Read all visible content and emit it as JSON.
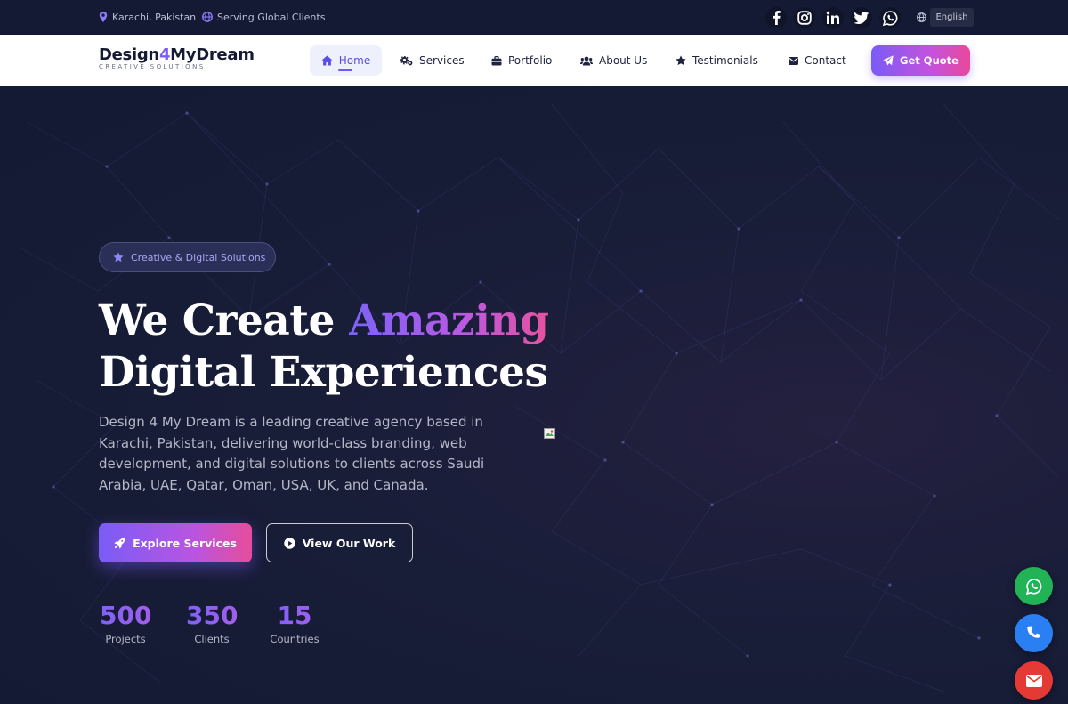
{
  "topbar": {
    "location": "Karachi, Pakistan",
    "service_area": "Serving Global Clients",
    "social": [
      "facebook-icon",
      "instagram-icon",
      "linkedin-icon",
      "twitter-icon",
      "whatsapp-icon"
    ],
    "language": "English"
  },
  "brand": {
    "name_part1": "Design",
    "name_part2": "4",
    "name_part3": "MyDream",
    "tagline": "CREATIVE SOLUTIONS"
  },
  "nav": {
    "items": [
      {
        "label": "Home",
        "icon": "home-icon",
        "active": true
      },
      {
        "label": "Services",
        "icon": "gears-icon"
      },
      {
        "label": "Portfolio",
        "icon": "briefcase-icon"
      },
      {
        "label": "About Us",
        "icon": "users-icon"
      },
      {
        "label": "Testimonials",
        "icon": "star-icon"
      },
      {
        "label": "Contact",
        "icon": "envelope-icon"
      }
    ],
    "cta": "Get Quote"
  },
  "hero": {
    "badge": "Creative & Digital Solutions",
    "title_line1_plain": "We Create",
    "title_line1_highlight": "Amazing",
    "title_line2": "Digital Experiences",
    "description": "Design 4 My Dream is a leading creative agency based in Karachi, Pakistan, delivering world-class branding, web development, and digital solutions to clients across Saudi Arabia, UAE, Qatar, Oman, USA, UK, and Canada.",
    "primary_button": "Explore Services",
    "secondary_button": "View Our Work",
    "stats": [
      {
        "value": "500",
        "label": "Projects"
      },
      {
        "value": "350",
        "label": "Clients"
      },
      {
        "value": "15",
        "label": "Countries"
      }
    ]
  },
  "floating": [
    "whatsapp-icon",
    "phone-icon",
    "envelope-icon"
  ],
  "colors": {
    "accent_start": "#7a5cf6",
    "accent_end": "#e9489a",
    "background": "#141a33",
    "whatsapp": "#22b357",
    "phone": "#2a7ff2",
    "mail": "#e53935"
  }
}
